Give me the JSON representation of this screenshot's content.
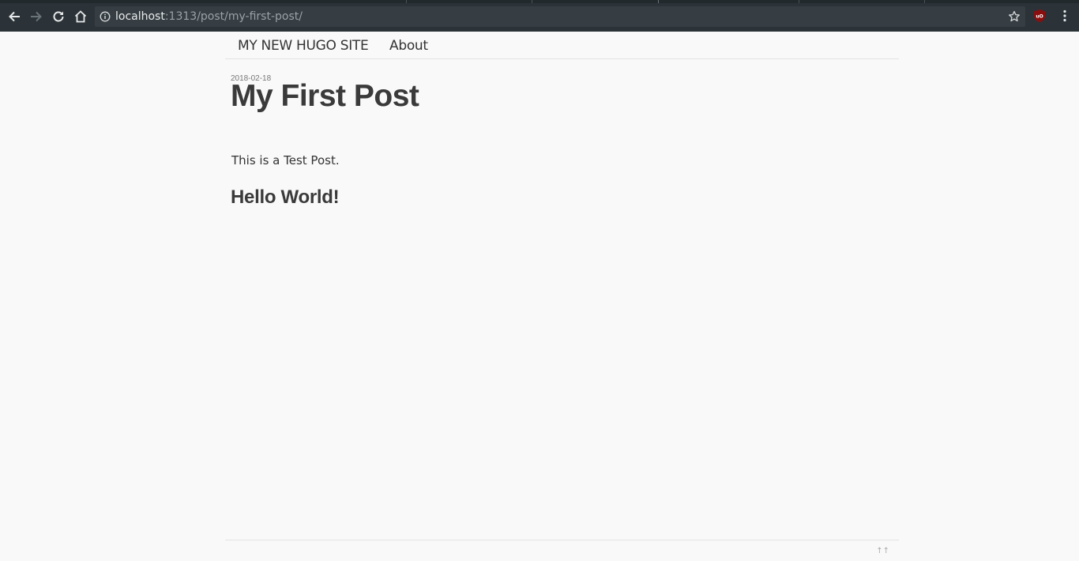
{
  "browser": {
    "url_host": "localhost",
    "url_path": ":1313/post/my-first-post/",
    "icons": {
      "back": "back-arrow-icon",
      "forward": "forward-arrow-icon",
      "reload": "reload-icon",
      "home": "home-icon",
      "info": "info-icon",
      "bookmark": "star-icon",
      "extension": "ublock-icon",
      "menu": "kebab-menu-icon"
    },
    "colors": {
      "chrome_bg": "#2b3338",
      "omnibox_bg": "#363e43",
      "extension_red": "#8b0e0e"
    }
  },
  "site": {
    "nav": {
      "brand": "MY NEW HUGO SITE",
      "about": "About"
    },
    "post": {
      "date": "2018-02-18",
      "title": "My First Post",
      "body": "This is a Test Post.",
      "heading": "Hello World!"
    },
    "footer": {
      "to_top": "↑↑"
    },
    "colors": {
      "page_bg": "#f9f9f9",
      "text": "#3a3a3a",
      "divider": "#e3e3e3"
    }
  }
}
